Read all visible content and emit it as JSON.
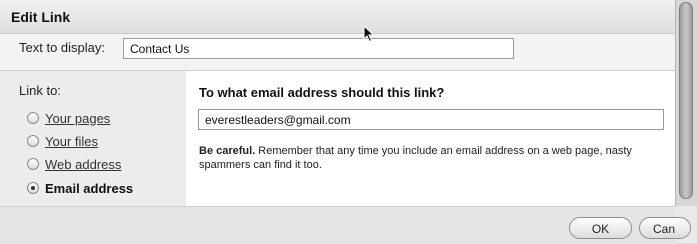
{
  "dialog": {
    "title": "Edit Link",
    "text_to_display_label": "Text to display:",
    "text_to_display_value": "Contact Us",
    "link_to_label": "Link to:",
    "options": [
      {
        "label": "Your pages",
        "selected": false
      },
      {
        "label": "Your files",
        "selected": false
      },
      {
        "label": "Web address",
        "selected": false
      },
      {
        "label": "Email address",
        "selected": true
      }
    ],
    "question": "To what email address should this link?",
    "email_value": "everestleaders@gmail.com",
    "warning_bold": "Be careful.",
    "warning_text": " Remember that any time you include an email address on a web page, nasty spammers can find it too.",
    "ok_label": "OK",
    "cancel_label": "Can"
  },
  "icons": {
    "cursor": "mouse-pointer-icon"
  }
}
